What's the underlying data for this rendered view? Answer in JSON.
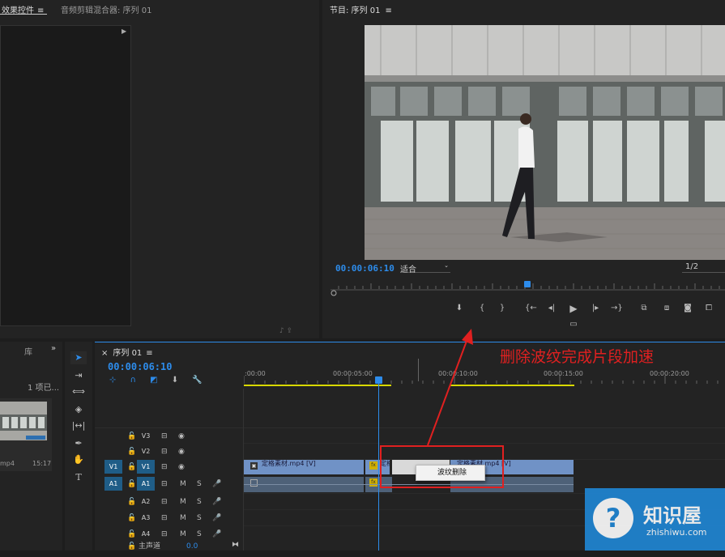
{
  "effects_panel": {
    "tab_effects": "效果控件",
    "tab_mixer": "音频剪辑混合器: 序列 01"
  },
  "program_monitor": {
    "title": "节目: 序列 01",
    "timecode": "00:00:06:10",
    "fit": "适合",
    "resolution": "1/2"
  },
  "project_panel": {
    "tab": "库",
    "count": "1 项已...",
    "clip_name": "mp4",
    "clip_duration": "15:17"
  },
  "timeline": {
    "tab": "序列 01",
    "timecode": "00:00:06:10",
    "ruler": [
      ":00:00",
      "00:00:05:00",
      "00:00:10:00",
      "00:00:15:00",
      "00:00:20:00"
    ],
    "tracks": [
      {
        "src": "",
        "name": "V3"
      },
      {
        "src": "",
        "name": "V2"
      },
      {
        "src": "V1",
        "name": "V1"
      },
      {
        "src": "A1",
        "name": "A1"
      },
      {
        "src": "",
        "name": "A2"
      },
      {
        "src": "",
        "name": "A3"
      },
      {
        "src": "",
        "name": "A4"
      }
    ],
    "master_label": "主声道",
    "master_value": "0.0",
    "clips": {
      "v1_a": "定格素材.mp4 [V]",
      "v1_b": "定格",
      "v1_c": "定格素材.mp4 [V]"
    },
    "context_menu": "波纹删除"
  },
  "annotation": {
    "text": "删除波纹完成片段加速",
    "color": "#e02020"
  },
  "watermark": {
    "brand": "知识屋",
    "url": "zhishiwu.com"
  },
  "icons": {
    "fx": "fx",
    "m": "M",
    "s": "S"
  }
}
